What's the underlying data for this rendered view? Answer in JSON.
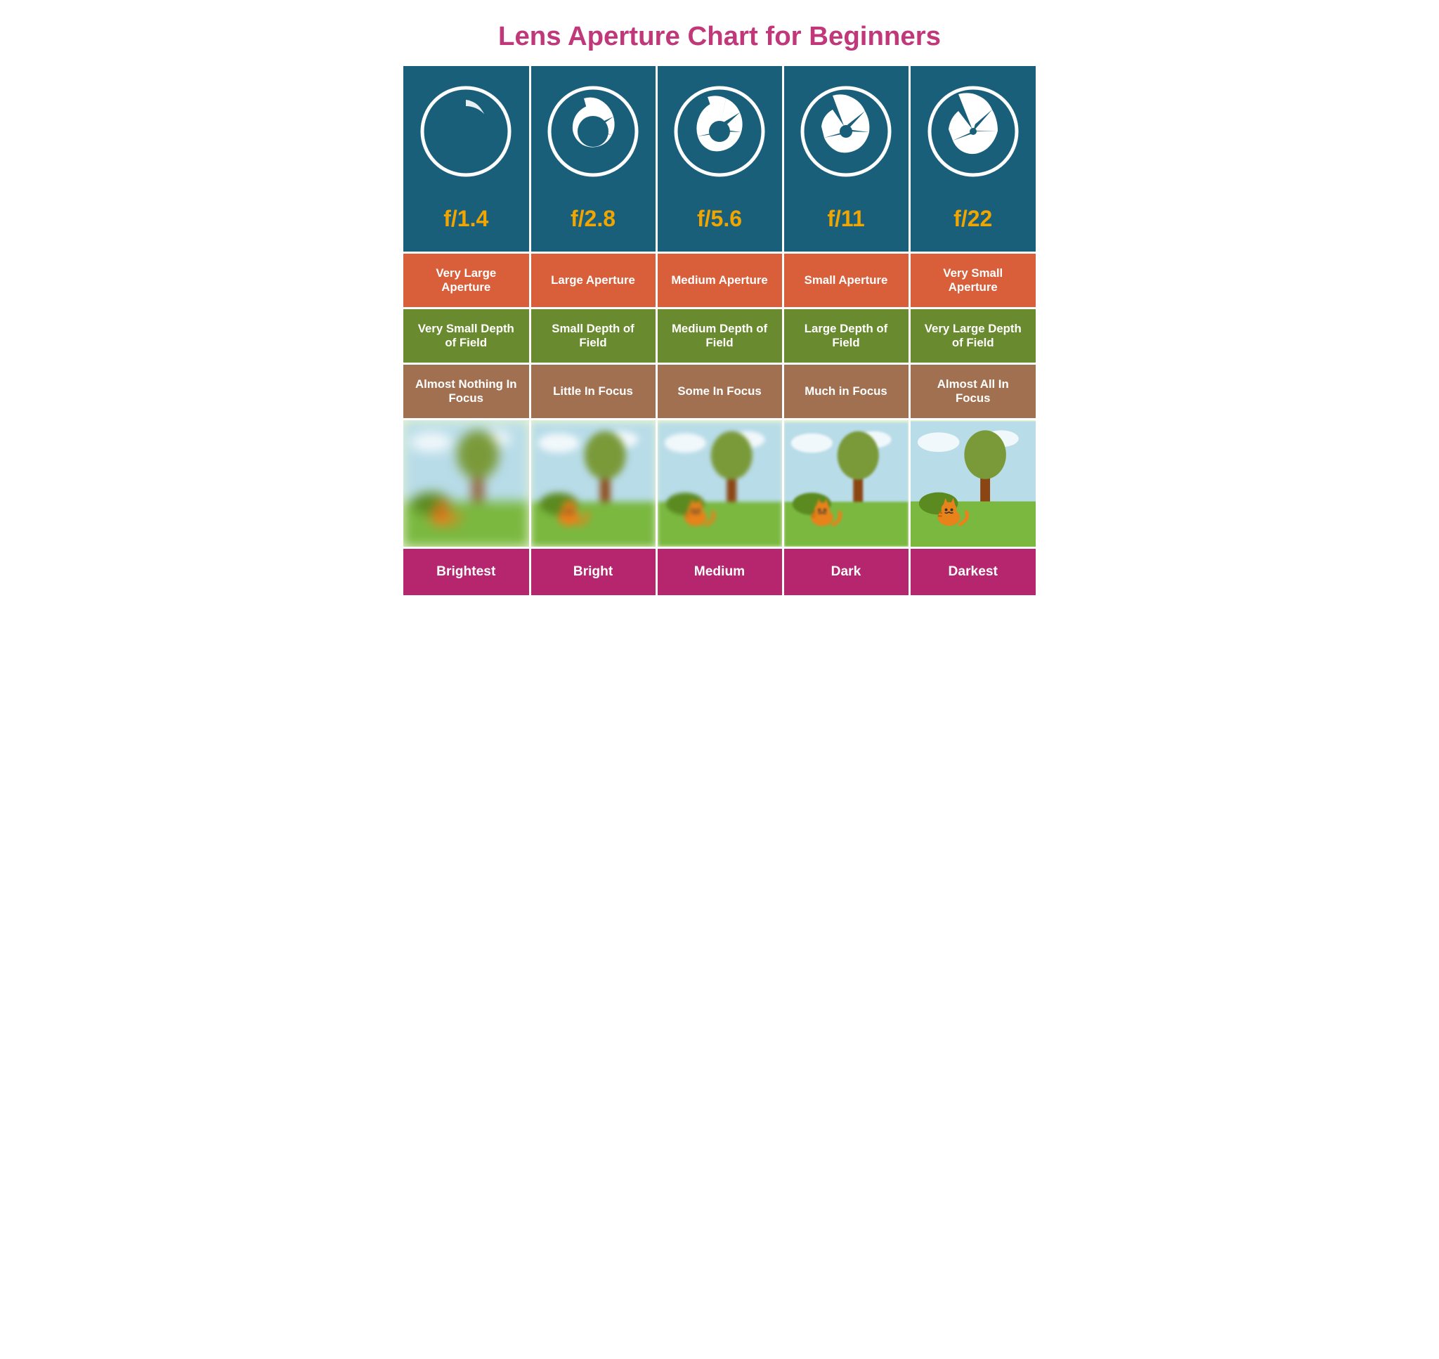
{
  "title": "Lens Aperture Chart for Beginners",
  "columns": [
    {
      "fstop": "f/1.4",
      "aperture_size": "Very Large Aperture",
      "dof": "Very Small Depth of Field",
      "focus": "Almost Nothing In Focus",
      "brightness": "Brightest",
      "blur_level": 4,
      "aperture_open": 0.95
    },
    {
      "fstop": "f/2.8",
      "aperture_size": "Large Aperture",
      "dof": "Small Depth of Field",
      "focus": "Little In Focus",
      "brightness": "Bright",
      "blur_level": 3,
      "aperture_open": 0.72
    },
    {
      "fstop": "f/5.6",
      "aperture_size": "Medium Aperture",
      "dof": "Medium Depth of Field",
      "focus": "Some In Focus",
      "brightness": "Medium",
      "blur_level": 2,
      "aperture_open": 0.5
    },
    {
      "fstop": "f/11",
      "aperture_size": "Small Aperture",
      "dof": "Large Depth of Field",
      "focus": "Much in Focus",
      "brightness": "Dark",
      "blur_level": 1,
      "aperture_open": 0.28
    },
    {
      "fstop": "f/22",
      "aperture_size": "Very Small Aperture",
      "dof": "Very Large Depth of Field",
      "focus": "Almost All In Focus",
      "brightness": "Darkest",
      "blur_level": 0,
      "aperture_open": 0.1
    }
  ]
}
